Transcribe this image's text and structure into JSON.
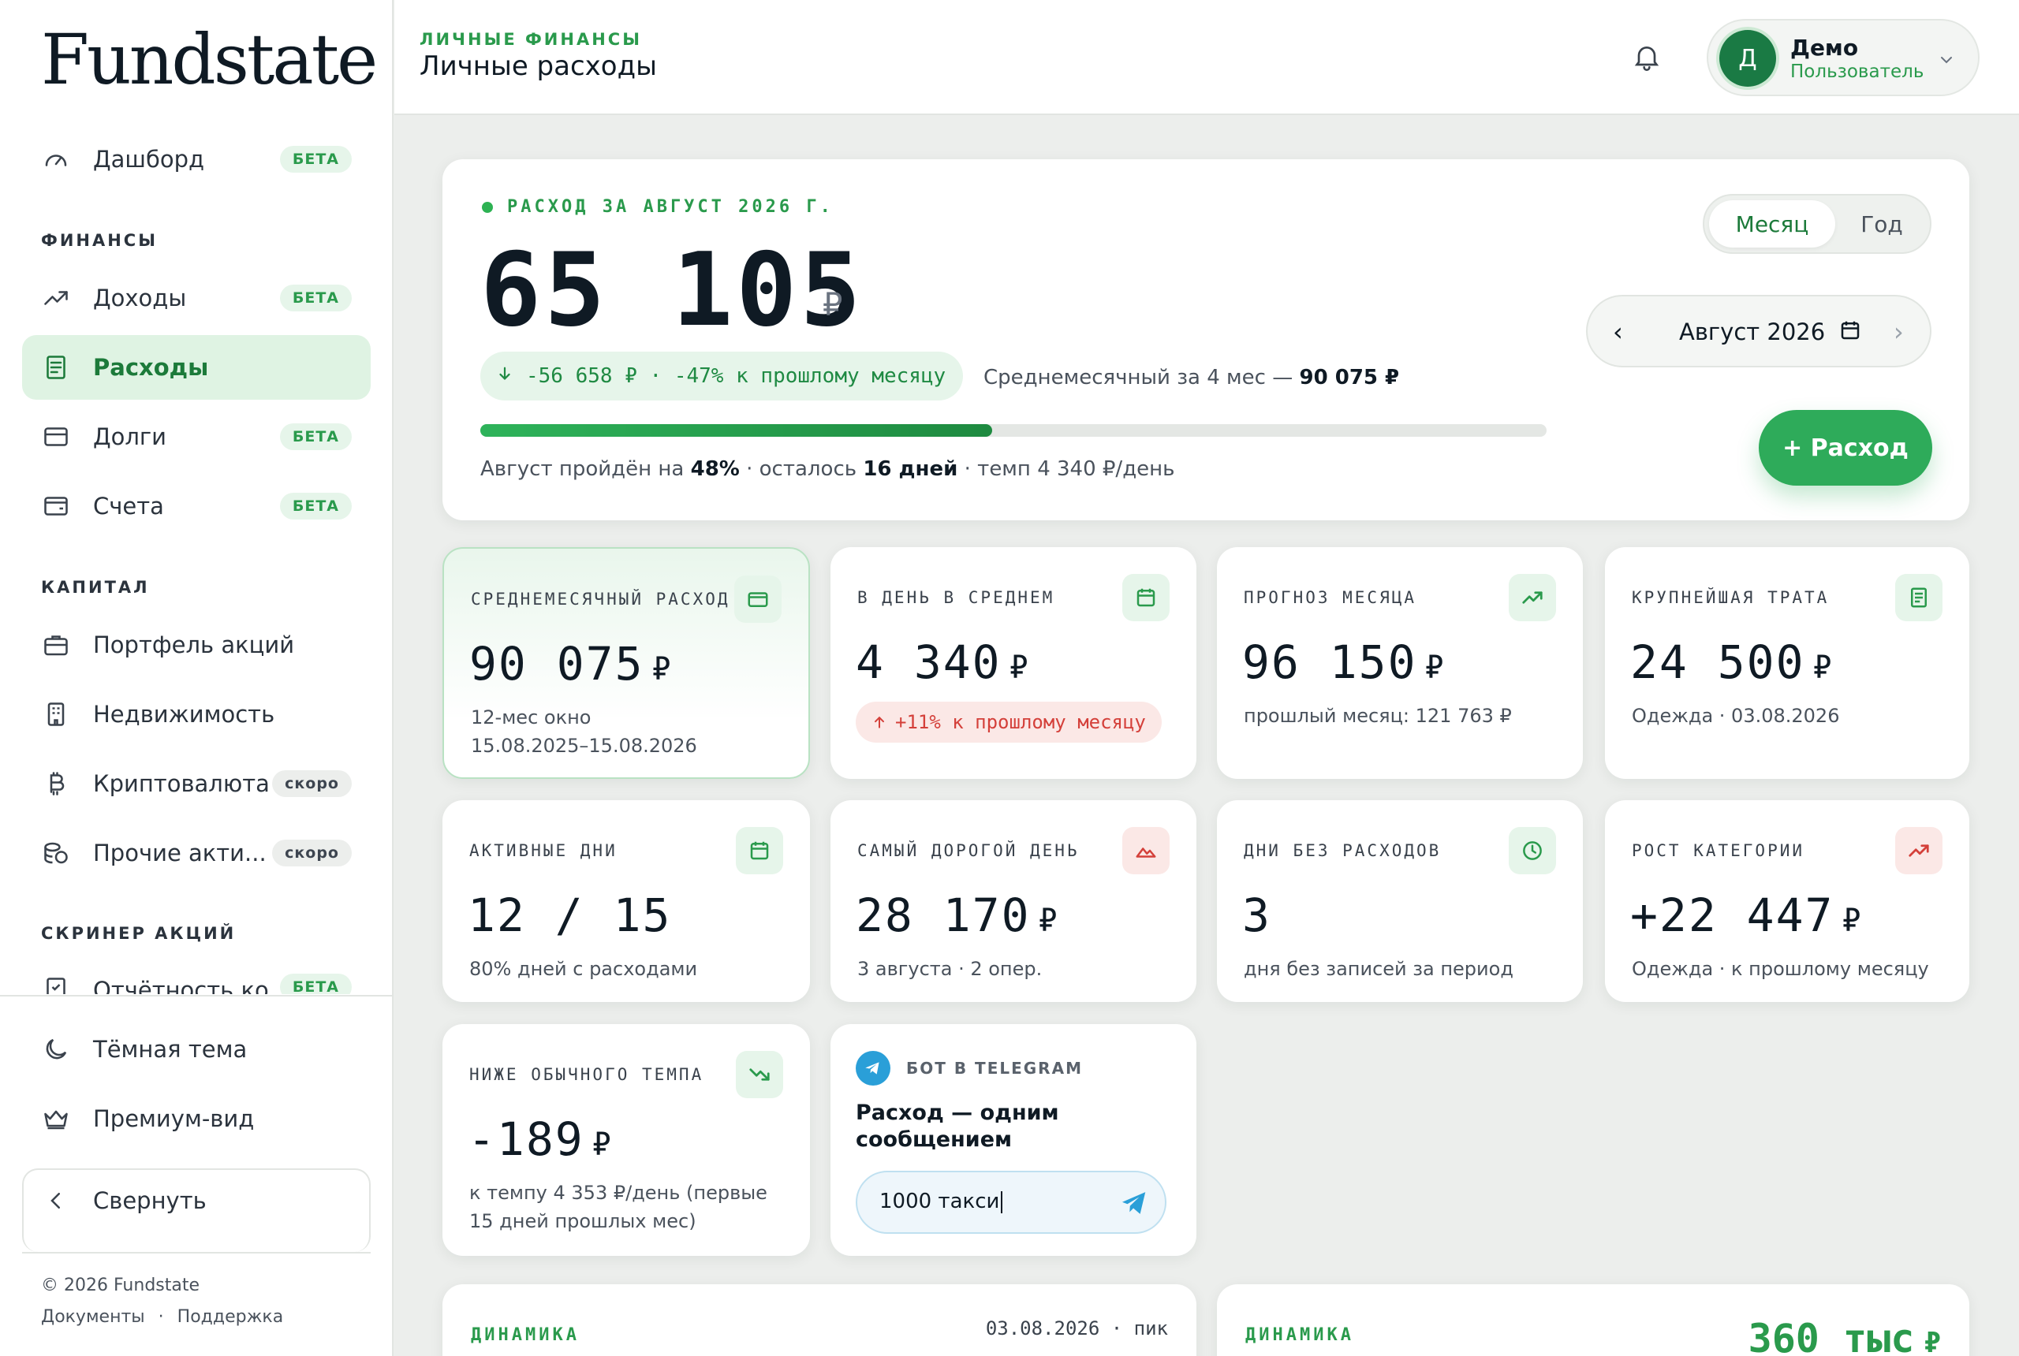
{
  "app": {
    "logo": "Fundstate"
  },
  "sidebar": {
    "dashboard": {
      "label": "Дашборд",
      "badge": "БЕТА"
    },
    "section_finance": "ФИНАНСЫ",
    "income": {
      "label": "Доходы",
      "badge": "БЕТА"
    },
    "expenses": {
      "label": "Расходы"
    },
    "debts": {
      "label": "Долги",
      "badge": "БЕТА"
    },
    "accounts": {
      "label": "Счета",
      "badge": "БЕТА"
    },
    "section_capital": "КАПИТАЛ",
    "stocks": {
      "label": "Портфель акций"
    },
    "realty": {
      "label": "Недвижимость"
    },
    "crypto": {
      "label": "Криптовалюта",
      "badge": "скоро"
    },
    "other_assets": {
      "label": "Прочие акти...",
      "badge": "скоро"
    },
    "section_screener": "СКРИНЕР АКЦИЙ",
    "reports": {
      "label": "Отчётность ко...",
      "badge": "БЕТА"
    },
    "dark_theme": "Тёмная тема",
    "premium": "Премиум-вид",
    "collapse": "Свернуть",
    "copyright": "© 2026 Fundstate",
    "docs": "Документы",
    "separator": "·",
    "support": "Поддержка"
  },
  "topbar": {
    "eyebrow": "ЛИЧНЫЕ ФИНАНСЫ",
    "title": "Личные расходы",
    "user": {
      "initial": "Д",
      "name": "Демо",
      "role": "Пользователь"
    }
  },
  "hero": {
    "kicker": "РАСХОД ЗА АВГУСТ 2026 Г.",
    "amount": "65 105",
    "currency": "₽",
    "delta_text": "-56 658 ₽ · -47% к прошлому месяцу",
    "avg_prefix": "Среднемесячный за 4 мес —",
    "avg_value": "90 075 ₽",
    "progress_fraction": 0.48,
    "progress_prefix": "Август пройдён на",
    "progress_percent": "48%",
    "progress_mid": "· осталось",
    "progress_days": "16 дней",
    "progress_suffix": "· темп 4 340 ₽/день",
    "period_month": "Месяц",
    "period_year": "Год",
    "date_label": "Август 2026",
    "add_button": "+ Расход"
  },
  "stats": [
    {
      "title": "СРЕДНЕМЕСЯЧНЫЙ РАСХОД",
      "value": "90 075",
      "currency": "₽",
      "sub": "12-мес окно 15.08.2025–15.08.2026",
      "icon": "card-icon"
    },
    {
      "title": "В ДЕНЬ В СРЕДНЕМ",
      "value": "4 340",
      "currency": "₽",
      "pill": "+11% к прошлому месяцу",
      "icon": "calendar-icon"
    },
    {
      "title": "ПРОГНОЗ МЕСЯЦА",
      "value": "96 150",
      "currency": "₽",
      "sub": "прошлый месяц: 121 763 ₽",
      "icon": "trend-up-icon"
    },
    {
      "title": "КРУПНЕЙШАЯ ТРАТА",
      "value": "24 500",
      "currency": "₽",
      "sub": "Одежда · 03.08.2026",
      "icon": "receipt-icon"
    },
    {
      "title": "АКТИВНЫЕ ДНИ",
      "value": "12 / 15",
      "currency": "",
      "sub": "80% дней с расходами",
      "icon": "calendar-icon"
    },
    {
      "title": "САМЫЙ ДОРОГОЙ ДЕНЬ",
      "value": "28 170",
      "currency": "₽",
      "sub": "3 августа · 2 опер.",
      "icon": "mountain-icon"
    },
    {
      "title": "ДНИ БЕЗ РАСХОДОВ",
      "value": "3",
      "currency": "",
      "sub": "дня без записей за период",
      "icon": "clock-icon"
    },
    {
      "title": "РОСТ КАТЕГОРИИ",
      "value": "+22 447",
      "currency": "₽",
      "sub": "Одежда · к прошлому месяцу",
      "icon": "trend-up-red-icon"
    },
    {
      "title": "НИЖЕ ОБЫЧНОГО ТЕМПА",
      "value": "-189",
      "currency": "₽",
      "sub": "к темпу 4 353 ₽/день (первые 15 дней прошлых мес)",
      "icon": "trend-down-icon"
    }
  ],
  "telegram": {
    "head": "БОТ В TELEGRAM",
    "title": "Расход — одним сообщением",
    "input_value": "1000 такси"
  },
  "bottom": {
    "left_kicker": "ДИНАМИКА",
    "left_right": "03.08.2026 · пик",
    "right_kicker": "ДИНАМИКА",
    "right_value": "360 тыс",
    "right_currency": "₽"
  },
  "colors": {
    "accent": "#2a9a4c",
    "accent_dark": "#1c7a3a",
    "negative": "#d4403a",
    "telegram": "#2a9fd8"
  }
}
